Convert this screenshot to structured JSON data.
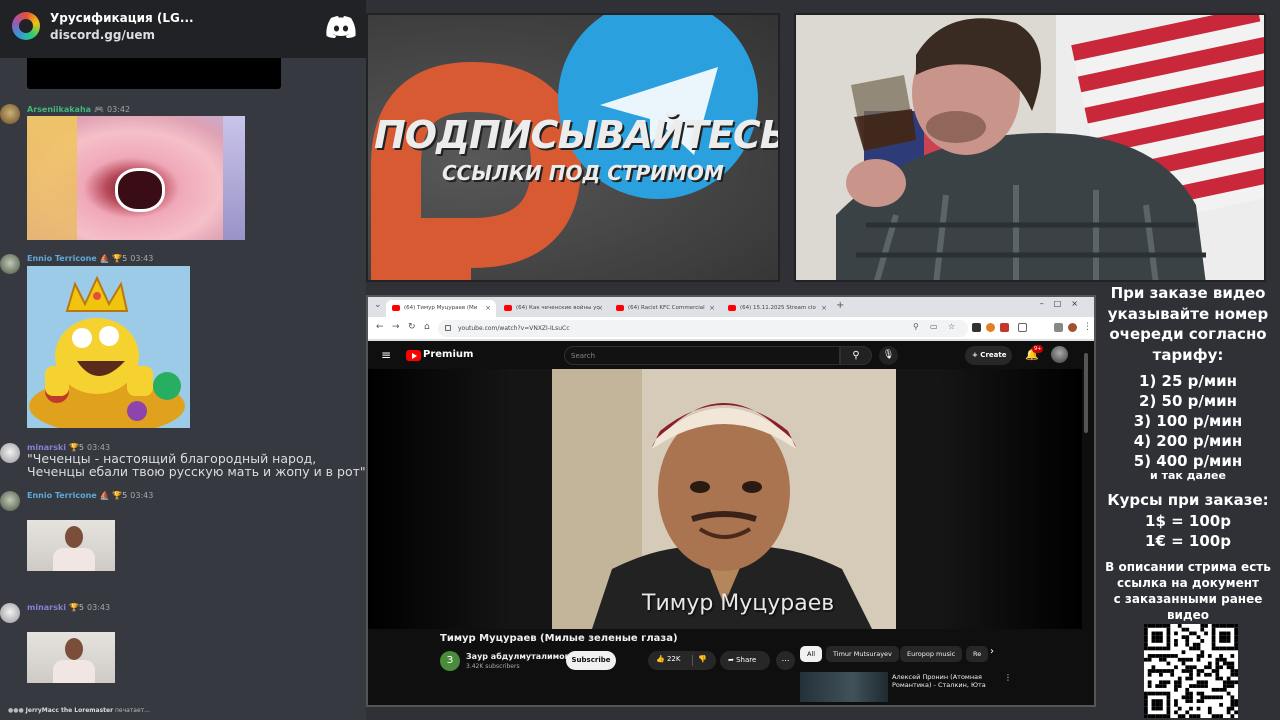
{
  "discord": {
    "server_name": "Урусификация (LG...",
    "invite": "discord.gg/uem",
    "messages": [
      {
        "author": "Arseniikakaha",
        "badge": "🎮",
        "time": "03:42",
        "color": "#43b581"
      },
      {
        "author": "Ennio Terricone",
        "badge": "⛵ 🏆5",
        "time": "03:43",
        "color": "#5fa8d8"
      },
      {
        "author": "minarski",
        "badge": "🏆5",
        "time": "03:43",
        "color": "#8a7fd4",
        "text": "\"Чеченцы - настоящий благородный народ, Чеченцы ебали твою русскую мать и жопу и в рот\""
      },
      {
        "author": "Ennio Terricone",
        "badge": "⛵ 🏆5",
        "time": "03:43",
        "color": "#5fa8d8"
      },
      {
        "author": "minarski",
        "badge": "🏆5",
        "time": "03:43",
        "color": "#8a7fd4"
      }
    ],
    "typing_user": "JerryMacc the Loremaster",
    "typing_suffix": "печатает..."
  },
  "promo": {
    "title": "ПОДПИСЫВАЙТЕСЬ",
    "subtitle": "ССЫЛКИ ПОД СТРИМОМ"
  },
  "browser": {
    "tabs": [
      {
        "label": "(64) Тимур Муцураев (Ми"
      },
      {
        "label": "(64) Как чеченские войны ус"
      },
      {
        "label": "(64) Racist KFC Commercial"
      },
      {
        "label": "(64) 15.11.2025 Stream clo"
      }
    ],
    "new_tab": "+",
    "url": "youtube.com/watch?v=VNXZI-ILsuCc"
  },
  "youtube": {
    "logo_text": "Premium",
    "search_placeholder": "Search",
    "create_label": "+ Create",
    "notif_count": "9+",
    "video_caption": "Тимур Муцураев",
    "video_title": "Тимур Муцураев (Милые зеленые глаза)",
    "channel_initial": "З",
    "channel_name": "Заур абдулмуталимов",
    "channel_subs": "3.42K subscribers",
    "subscribe_label": "Subscribe",
    "like_count": "22K",
    "share_label": "Share",
    "chips": [
      "All",
      "Timur Mutsurayev",
      "Europop music",
      "Re"
    ],
    "rec_title_line1": "Алексей Пронин (Атомная",
    "rec_title_line2": "Романтика) - Сталкин, Юта"
  },
  "info_panel": {
    "order_lines": [
      "При заказе видео",
      "указывайте номер",
      "очереди согласно",
      "тарифу:"
    ],
    "tariffs": [
      "1) 25 р/мин",
      "2) 50 р/мин",
      "3) 100 р/мин",
      "4) 200 р/мин",
      "5) 400 р/мин"
    ],
    "etc": "и так далее",
    "rates_title": "Курсы при заказе:",
    "rates": [
      "1$ = 100р",
      "1€ = 100р"
    ],
    "desc_lines": [
      "В описании стрима есть",
      "ссылка на документ",
      "с заказанными ранее",
      "видео"
    ]
  },
  "colors": {
    "discord_bg": "#36393f",
    "youtube_red": "#ff0000",
    "telegram_blue": "#2aa1de",
    "boosty_orange": "#d85a33"
  }
}
